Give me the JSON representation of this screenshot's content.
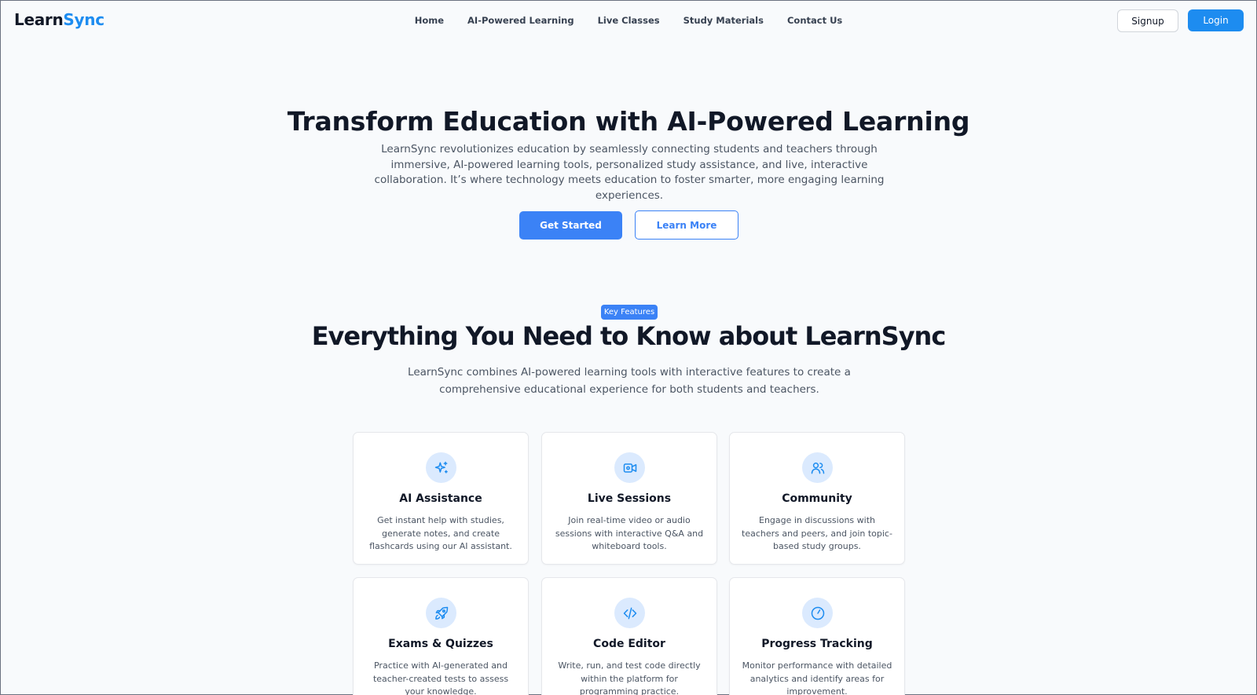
{
  "brand": {
    "name_part1": "Learn",
    "name_part2": "Sync"
  },
  "nav": {
    "items": [
      {
        "label": "Home"
      },
      {
        "label": "AI-Powered Learning"
      },
      {
        "label": "Live Classes"
      },
      {
        "label": "Study Materials"
      },
      {
        "label": "Contact Us"
      }
    ]
  },
  "auth": {
    "signup_label": "Signup",
    "login_label": "Login"
  },
  "hero": {
    "title": "Transform Education with AI-Powered Learning",
    "description": "LearnSync revolutionizes education by seamlessly connecting students and teachers through immersive, AI-powered learning tools, personalized study assistance, and live, interactive collaboration. It’s where technology meets education to foster smarter, more engaging learning experiences.",
    "primary_cta": "Get Started",
    "secondary_cta": "Learn More"
  },
  "features": {
    "badge": "Key Features",
    "title": "Everything You Need to Know about LearnSync",
    "description": "LearnSync combines AI-powered learning tools with interactive features to create a comprehensive educational experience for both students and teachers.",
    "cards": [
      {
        "icon": "sparkles-icon",
        "title": "AI Assistance",
        "text": "Get instant help with studies, generate notes, and create flashcards using our AI assistant."
      },
      {
        "icon": "video-icon",
        "title": "Live Sessions",
        "text": "Join real-time video or audio sessions with interactive Q&A and whiteboard tools."
      },
      {
        "icon": "users-icon",
        "title": "Community",
        "text": "Engage in discussions with teachers and peers, and join topic-based study groups."
      },
      {
        "icon": "rocket-icon",
        "title": "Exams & Quizzes",
        "text": "Practice with AI-generated and teacher-created tests to assess your knowledge."
      },
      {
        "icon": "code-icon",
        "title": "Code Editor",
        "text": "Write, run, and test code directly within the platform for programming practice."
      },
      {
        "icon": "gauge-icon",
        "title": "Progress Tracking",
        "text": "Monitor performance with detailed analytics and identify areas for improvement."
      }
    ]
  },
  "colors": {
    "accent": "#1d8cf0",
    "primary_button": "#3b82f6",
    "icon_circle": "#dbeafe",
    "page_background": "#f8fafc"
  }
}
